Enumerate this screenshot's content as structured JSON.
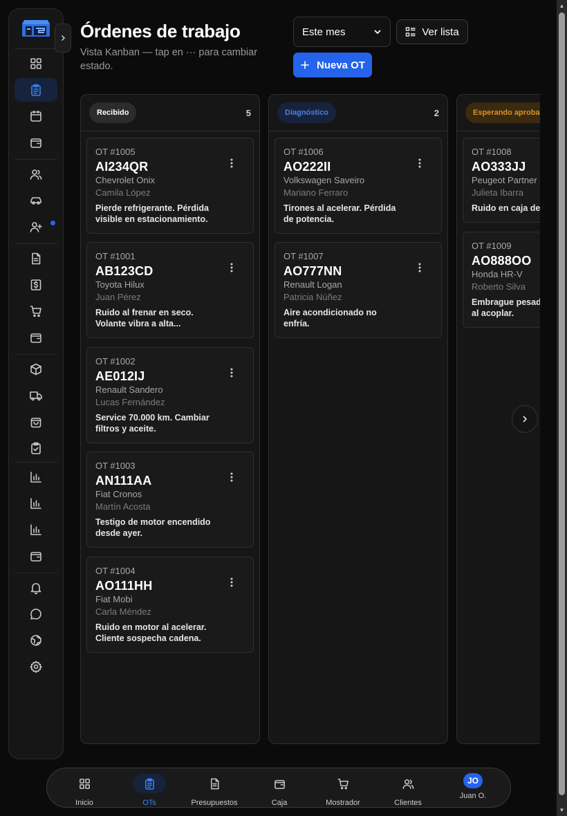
{
  "header": {
    "title": "Órdenes de trabajo",
    "subtitle": "Vista Kanban — tap en ··· para cambiar estado.",
    "period_value": "Este mes",
    "list_button": "Ver lista",
    "new_button": "Nueva OT"
  },
  "sidebar": {
    "items": [
      {
        "icon": "dashboard-icon"
      },
      {
        "icon": "clipboard-icon",
        "active": true
      },
      {
        "icon": "calendar-icon"
      },
      {
        "icon": "wallet-icon"
      },
      {
        "icon": "users-icon"
      },
      {
        "icon": "car-icon"
      },
      {
        "icon": "user-plus-icon",
        "badge": true
      },
      {
        "icon": "document-icon"
      },
      {
        "icon": "dollar-icon"
      },
      {
        "icon": "cart-icon"
      },
      {
        "icon": "wallet-icon"
      },
      {
        "icon": "box-icon"
      },
      {
        "icon": "truck-icon"
      },
      {
        "icon": "bag-icon"
      },
      {
        "icon": "clipboard-check-icon"
      },
      {
        "icon": "chart-icon"
      },
      {
        "icon": "chart-icon"
      },
      {
        "icon": "chart-icon"
      },
      {
        "icon": "wallet-icon"
      },
      {
        "icon": "bell-icon"
      },
      {
        "icon": "chat-icon"
      },
      {
        "icon": "globe-icon"
      },
      {
        "icon": "gear-icon"
      }
    ]
  },
  "columns": [
    {
      "label": "Recibido",
      "count": "5",
      "color": "#2c2c2c",
      "cards": [
        {
          "ot": "OT #1005",
          "plate": "AI234QR",
          "car": "Chevrolet Onix",
          "client": "Camila López",
          "desc1": "Pierde refrigerante. Pérdida",
          "desc2": "visible en estacionamiento."
        },
        {
          "ot": "OT #1001",
          "plate": "AB123CD",
          "car": "Toyota Hilux",
          "client": "Juan Pérez",
          "desc1": "Ruido al frenar en seco.",
          "desc2": "Volante vibra a alta..."
        },
        {
          "ot": "OT #1002",
          "plate": "AE012IJ",
          "car": "Renault Sandero",
          "client": "Lucas Fernández",
          "desc1": "Service 70.000 km. Cambiar",
          "desc2": "filtros y aceite."
        },
        {
          "ot": "OT #1003",
          "plate": "AN111AA",
          "car": "Fiat Cronos",
          "client": "Martín Acosta",
          "desc1": "Testigo de motor encendido",
          "desc2": "desde ayer."
        },
        {
          "ot": "OT #1004",
          "plate": "AO111HH",
          "car": "Fiat Mobi",
          "client": "Carla Méndez",
          "desc1": "Ruido en motor al acelerar.",
          "desc2": "Cliente sospecha cadena."
        }
      ]
    },
    {
      "label": "Diagnóstico",
      "count": "2",
      "color": "#4f7fe0",
      "cards": [
        {
          "ot": "OT #1006",
          "plate": "AO222II",
          "car": "Volkswagen Saveiro",
          "client": "Mariano Ferraro",
          "desc1": "Tirones al acelerar. Pérdida",
          "desc2": "de potencia."
        },
        {
          "ot": "OT #1007",
          "plate": "AO777NN",
          "car": "Renault Logan",
          "client": "Patricia Núñez",
          "desc1": "Aire acondicionado no",
          "desc2": "enfría."
        }
      ]
    },
    {
      "label": "Esperando aprobación",
      "count": "",
      "color": "#d8922a",
      "cards": [
        {
          "ot": "OT #1008",
          "plate": "AO333JJ",
          "car": "Peugeot Partner",
          "client": "Julieta Ibarra",
          "desc1": "Ruido en caja de cambios",
          "desc2": ""
        },
        {
          "ot": "OT #1009",
          "plate": "AO888OO",
          "car": "Honda HR-V",
          "client": "Roberto Silva",
          "desc1": "Embrague pesado",
          "desc2": "al acoplar."
        }
      ]
    }
  ],
  "bottom_nav": {
    "items": [
      {
        "label": "Inicio",
        "icon": "dashboard-icon"
      },
      {
        "label": "OTs",
        "icon": "clipboard-icon",
        "active": true
      },
      {
        "label": "Presupuestos",
        "icon": "document-icon"
      },
      {
        "label": "Caja",
        "icon": "wallet-icon"
      },
      {
        "label": "Mostrador",
        "icon": "cart-icon"
      },
      {
        "label": "Clientes",
        "icon": "users-icon"
      }
    ],
    "user_initials": "JO",
    "user_name": "Juan O."
  }
}
